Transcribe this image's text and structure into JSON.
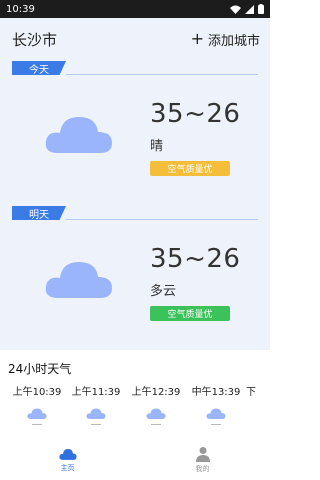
{
  "status_bar": {
    "time": "10:39"
  },
  "header": {
    "city": "长沙市",
    "add_city": "添加城市",
    "add_icon": "plus-icon"
  },
  "days": [
    {
      "label": "今天",
      "temp": "35~26",
      "condition": "晴",
      "aqi": "空气质量优",
      "aqi_color": "#f4be3a"
    },
    {
      "label": "明天",
      "temp": "35~26",
      "condition": "多云",
      "aqi": "空气质量优",
      "aqi_color": "#3cc25a"
    }
  ],
  "hourly": {
    "title": "24小时天气",
    "items": [
      {
        "time": "上午10:39"
      },
      {
        "time": "上午11:39"
      },
      {
        "time": "上午12:39"
      },
      {
        "time": "中午13:39"
      },
      {
        "time": "下"
      }
    ]
  },
  "bottom_nav": [
    {
      "label": "主页",
      "icon": "cloud-icon",
      "color": "#2f6fe0"
    },
    {
      "label": "我的",
      "icon": "user-icon",
      "color": "#999999"
    }
  ],
  "colors": {
    "accent": "#3a7be6",
    "cloud": "#9ab5fb",
    "panel_bg": "#eef2fb"
  }
}
